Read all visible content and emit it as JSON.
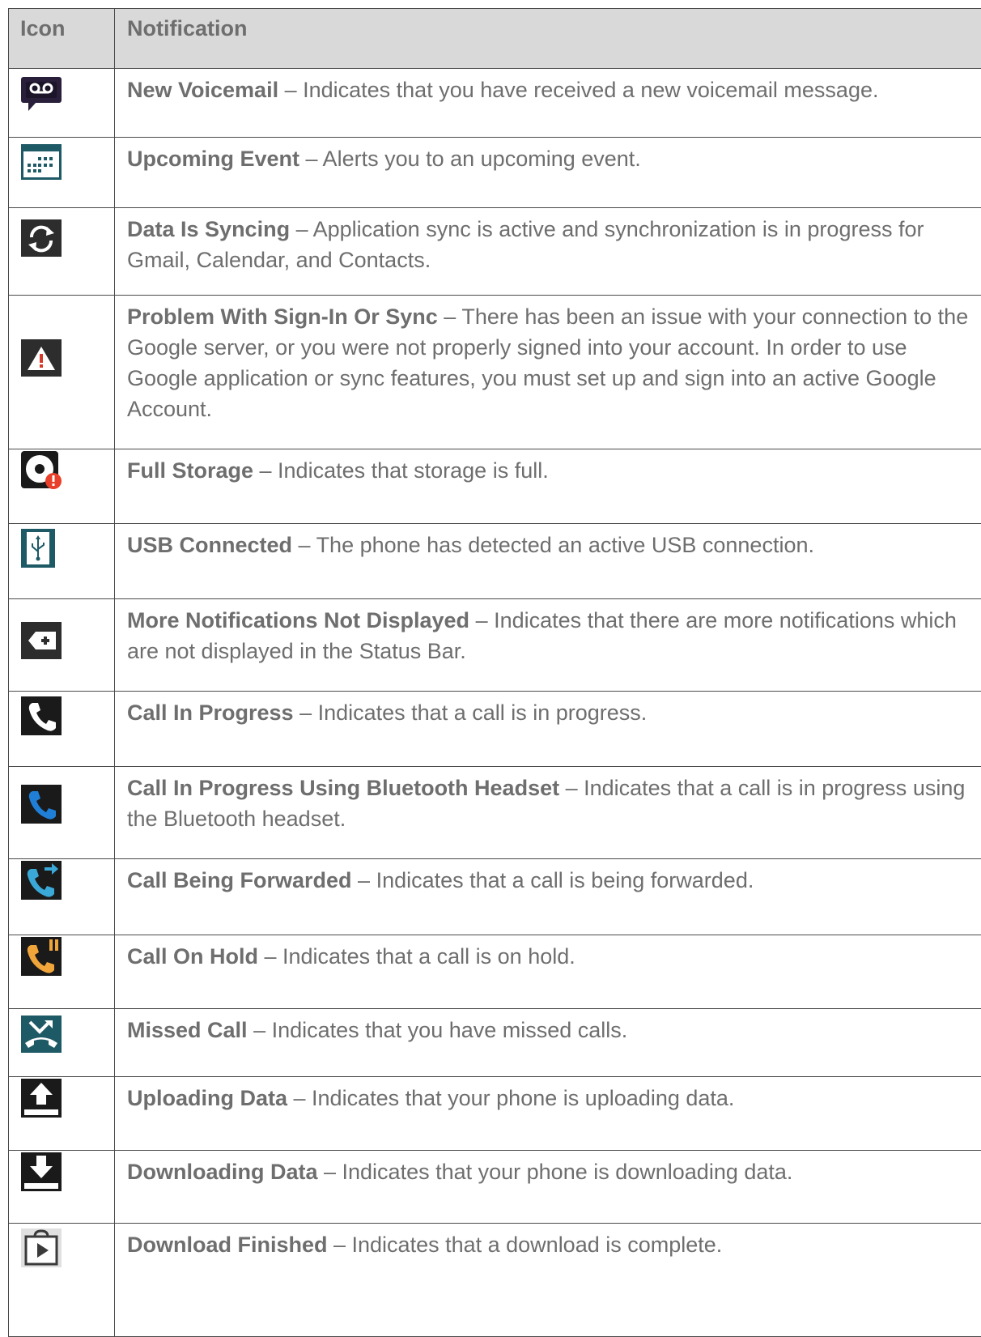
{
  "table": {
    "headers": [
      "Icon",
      "Notification"
    ],
    "rows": [
      {
        "icon": "voicemail-icon",
        "title": "New Voicemail",
        "desc": " – Indicates that you have received a new voicemail message."
      },
      {
        "icon": "calendar-icon",
        "title": "Upcoming Event",
        "desc": " – Alerts you to an upcoming event."
      },
      {
        "icon": "sync-icon",
        "title": "Data Is Syncing",
        "desc": " – Application sync is active and synchronization is in progress for Gmail, Calendar, and Contacts."
      },
      {
        "icon": "warning-icon",
        "title": "Problem With Sign-In Or Sync",
        "desc": " – There has been an issue with your connection to the Google server, or you were not properly signed into your account. In order to use Google application or sync features, you must set up and sign into an active Google Account."
      },
      {
        "icon": "storage-full-icon",
        "title": "Full Storage",
        "desc": " – Indicates that storage is full."
      },
      {
        "icon": "usb-icon",
        "title": "USB Connected",
        "desc": " – The phone has detected an active USB connection."
      },
      {
        "icon": "more-notifications-icon",
        "title": "More Notifications Not Displayed",
        "desc": " – Indicates that there are more notifications which are not displayed in the Status Bar."
      },
      {
        "icon": "call-in-progress-icon",
        "title": "Call In Progress",
        "desc": " – Indicates that a call is in progress."
      },
      {
        "icon": "bluetooth-call-icon",
        "title": "Call In Progress Using Bluetooth Headset",
        "desc": " – Indicates that a call is in progress using the Bluetooth headset."
      },
      {
        "icon": "call-forwarded-icon",
        "title": "Call Being Forwarded",
        "desc": " – Indicates that a call is being forwarded."
      },
      {
        "icon": "call-hold-icon",
        "title": "Call On Hold",
        "desc": " – Indicates that a call is on hold."
      },
      {
        "icon": "missed-call-icon",
        "title": "Missed Call",
        "desc": " – Indicates that you have missed calls."
      },
      {
        "icon": "upload-icon",
        "title": "Uploading Data",
        "desc": " – Indicates that your phone is uploading data."
      },
      {
        "icon": "download-icon",
        "title": "Downloading Data",
        "desc": " – Indicates that your phone is downloading data."
      },
      {
        "icon": "download-finished-icon",
        "title": "Download Finished",
        "desc": " – Indicates that a download is complete."
      }
    ]
  }
}
